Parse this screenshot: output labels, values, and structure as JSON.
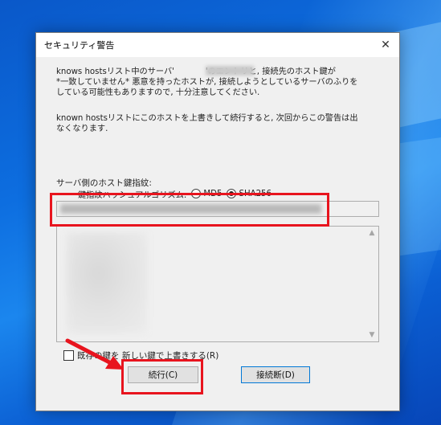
{
  "dialog": {
    "title": "セキュリティ警告",
    "close_glyph": "✕",
    "message1": "knows hostsリスト中のサーバ'            'のエントリと, 接続先のホスト鍵が\n*一致していません* 悪意を持ったホストが, 接続しようとしているサーバのふりを\nしている可能性もありますので, 十分注意してください.",
    "message2": "known hostsリストにこのホストを上書きして続行すると, 次回からこの警告は出\nなくなります.",
    "fingerprint_label": "サーバ側のホスト鍵指紋:",
    "hash_label": "鍵指紋ハッシュアルゴリズム:",
    "hash_options": [
      "MD5",
      "SHA256"
    ],
    "hash_selected": "SHA256",
    "overwrite_checkbox_label": "既存の鍵を 新しい鍵で上書きする(R)",
    "continue_button": "続行(C)",
    "disconnect_button": "接続断(D)"
  },
  "icons": {
    "scroll_up": "▲",
    "scroll_down": "▼"
  },
  "colors": {
    "highlight": "#e8141e",
    "focus": "#0078d7"
  }
}
